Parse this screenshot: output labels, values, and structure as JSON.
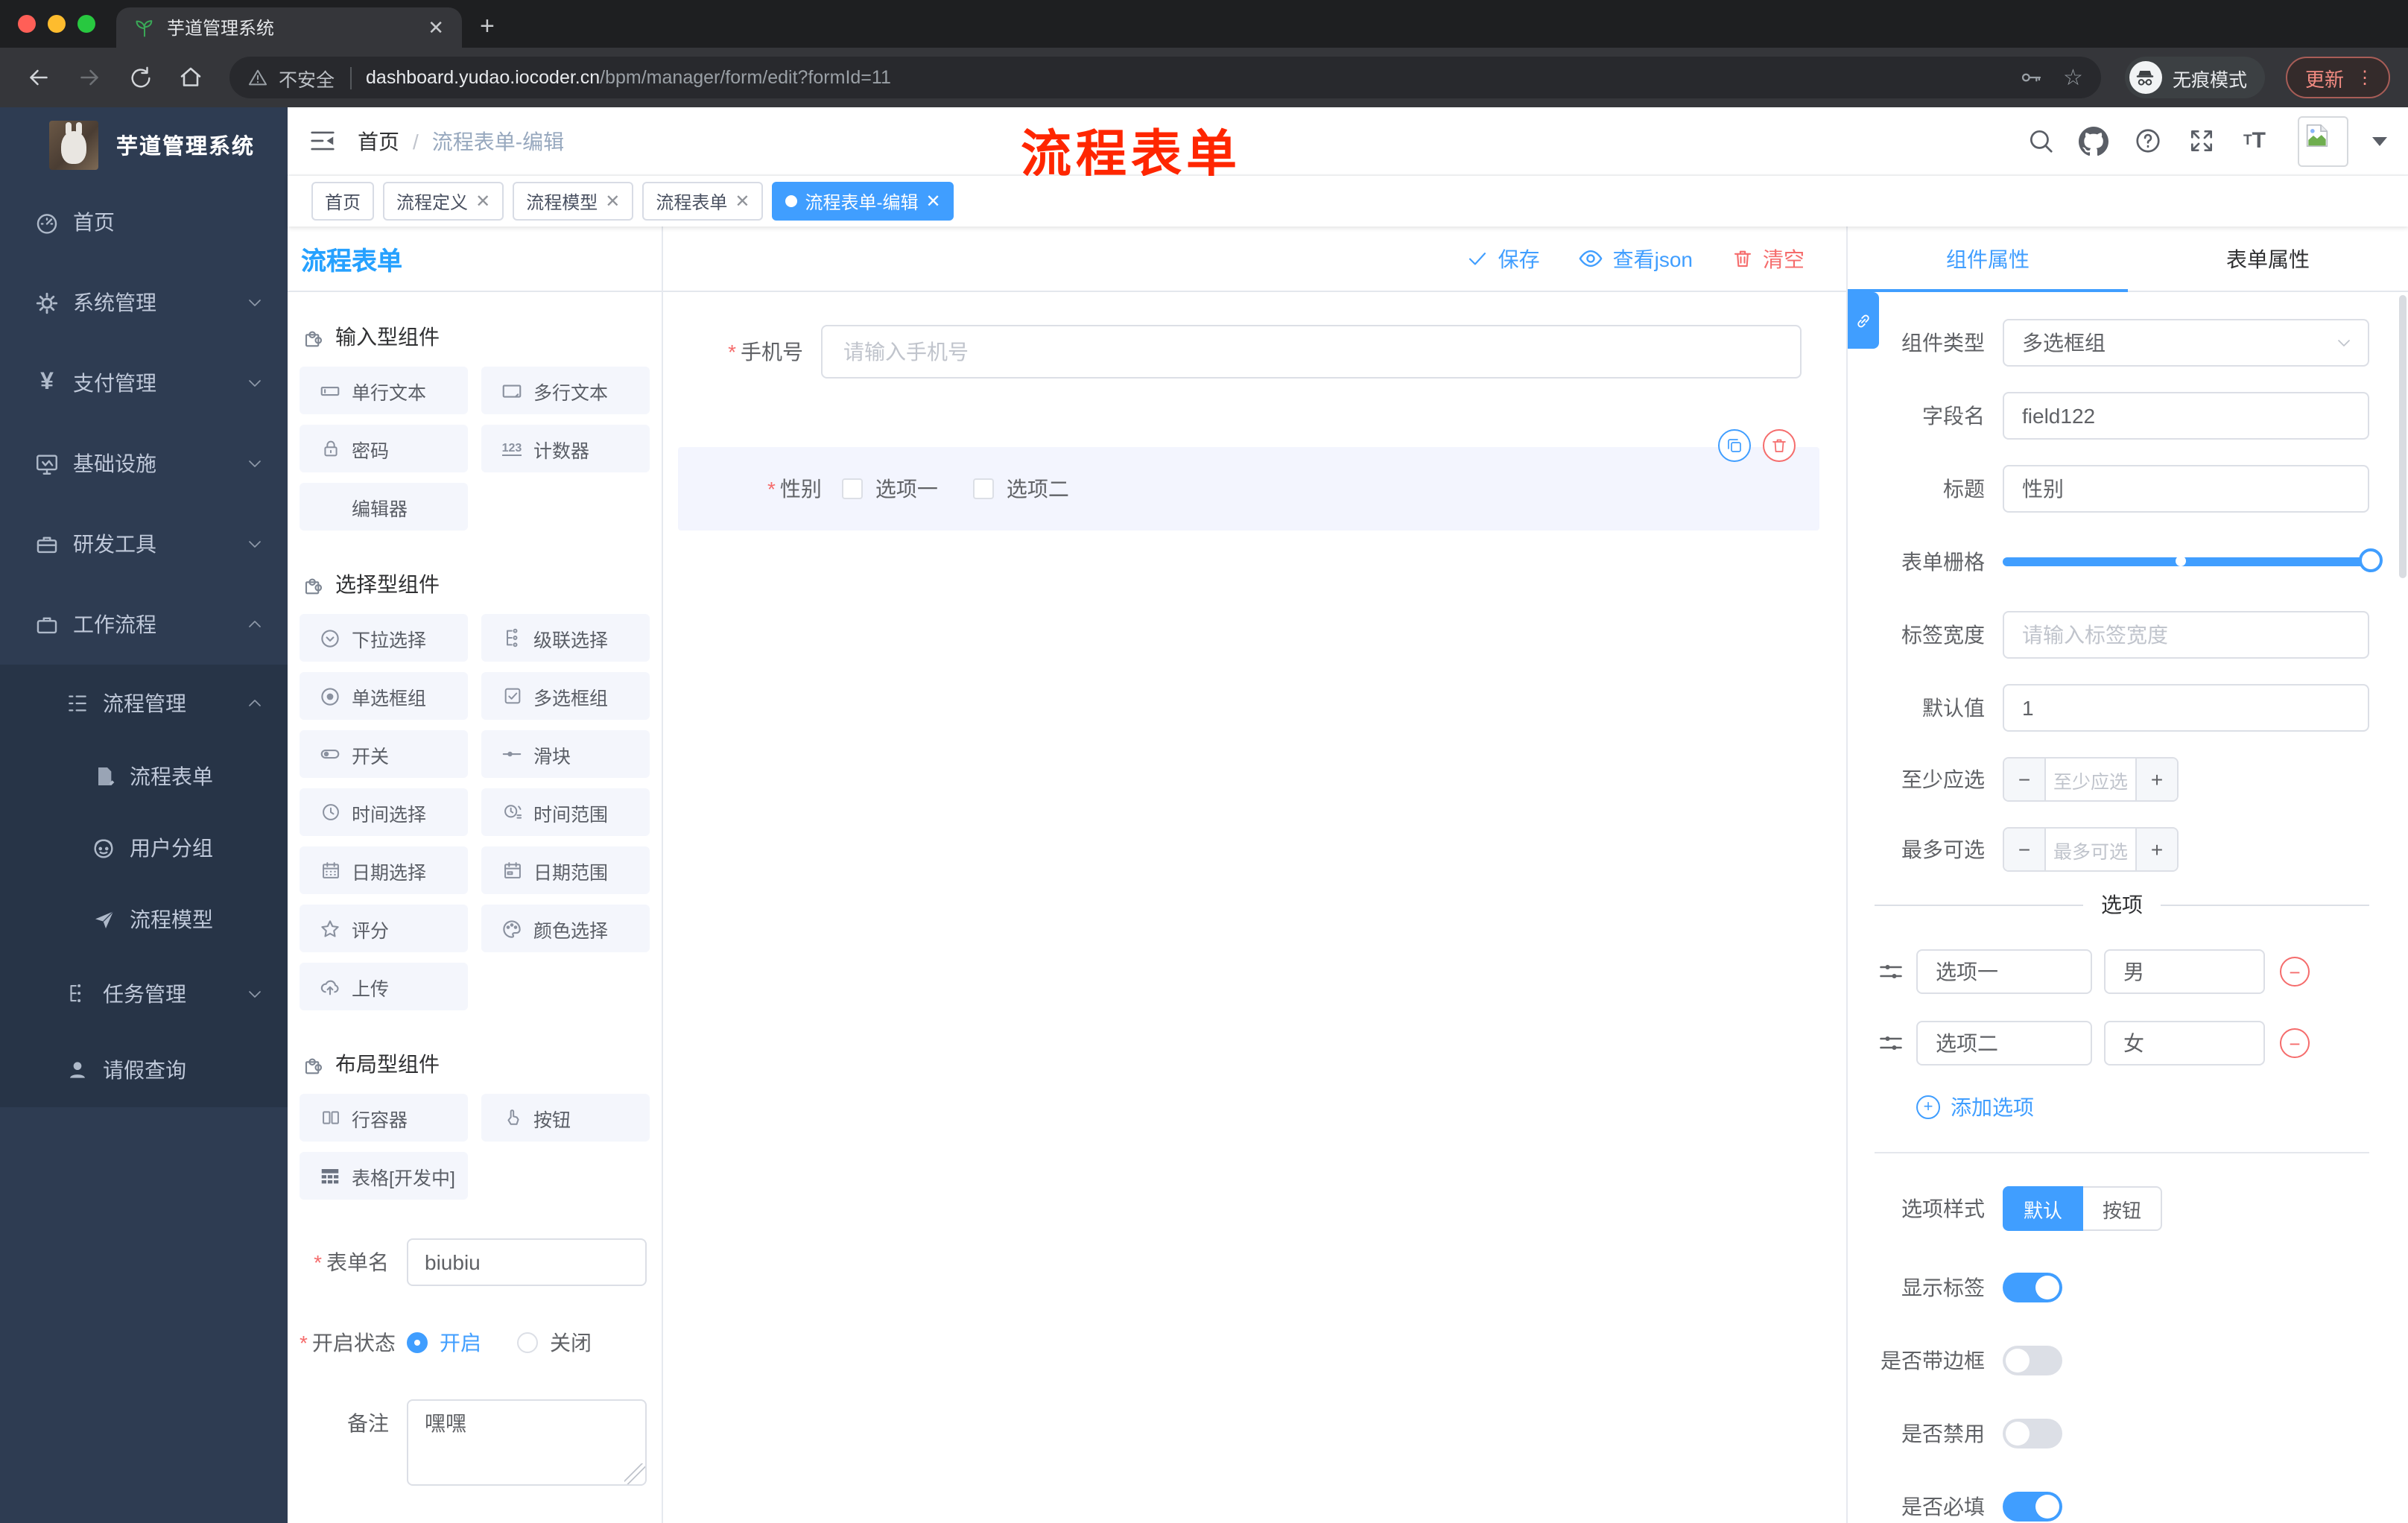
{
  "browser": {
    "tab_title": "芋道管理系统",
    "security_label": "不安全",
    "url_domain": "dashboard.yudao.iocoder.cn",
    "url_path": "/bpm/manager/form/edit?formId=11",
    "incognito_label": "无痕模式",
    "update_label": "更新"
  },
  "annotation_text": "流程表单",
  "sidebar": {
    "logo_title": "芋道管理系统",
    "items": [
      {
        "label": "首页"
      },
      {
        "label": "系统管理"
      },
      {
        "label": "支付管理"
      },
      {
        "label": "基础设施"
      },
      {
        "label": "研发工具"
      },
      {
        "label": "工作流程"
      },
      {
        "label": "流程管理"
      },
      {
        "label": "流程表单"
      },
      {
        "label": "用户分组"
      },
      {
        "label": "流程模型"
      },
      {
        "label": "任务管理"
      },
      {
        "label": "请假查询"
      }
    ]
  },
  "header": {
    "breadcrumb_home": "首页",
    "breadcrumb_current": "流程表单-编辑"
  },
  "tags": [
    {
      "label": "首页"
    },
    {
      "label": "流程定义"
    },
    {
      "label": "流程模型"
    },
    {
      "label": "流程表单"
    },
    {
      "label": "流程表单-编辑"
    }
  ],
  "left_panel": {
    "title": "流程表单",
    "sections": [
      {
        "title": "输入型组件",
        "items": [
          "单行文本",
          "多行文本",
          "密码",
          "计数器",
          "编辑器"
        ]
      },
      {
        "title": "选择型组件",
        "items": [
          "下拉选择",
          "级联选择",
          "单选框组",
          "多选框组",
          "开关",
          "滑块",
          "时间选择",
          "时间范围",
          "日期选择",
          "日期范围",
          "评分",
          "颜色选择",
          "上传"
        ]
      },
      {
        "title": "布局型组件",
        "items": [
          "行容器",
          "按钮",
          "表格[开发中]"
        ]
      }
    ],
    "form": {
      "name_label": "表单名",
      "name_value": "biubiu",
      "status_label": "开启状态",
      "status_on": "开启",
      "status_off": "关闭",
      "remark_label": "备注",
      "remark_value": "嘿嘿"
    }
  },
  "canvas": {
    "save_label": "保存",
    "view_json_label": "查看json",
    "clear_label": "清空",
    "phone_label": "手机号",
    "phone_placeholder": "请输入手机号",
    "gender_label": "性别",
    "gender_option1": "选项一",
    "gender_option2": "选项二"
  },
  "right_panel": {
    "tab_component": "组件属性",
    "tab_form": "表单属性",
    "type_label": "组件类型",
    "type_value": "多选框组",
    "field_label": "字段名",
    "field_value": "field122",
    "title_label": "标题",
    "title_value": "性别",
    "grid_label": "表单栅格",
    "label_width_label": "标签宽度",
    "label_width_placeholder": "请输入标签宽度",
    "default_label": "默认值",
    "default_value": "1",
    "min_label": "至少应选",
    "min_placeholder": "至少应选",
    "max_label": "最多可选",
    "max_placeholder": "最多可选",
    "options_title": "选项",
    "options": [
      {
        "name": "选项一",
        "value": "男"
      },
      {
        "name": "选项二",
        "value": "女"
      }
    ],
    "add_option_label": "添加选项",
    "style_label": "选项样式",
    "style_default": "默认",
    "style_button": "按钮",
    "show_label_label": "显示标签",
    "border_label": "是否带边框",
    "disabled_label": "是否禁用",
    "required_label": "是否必填"
  },
  "colors": {
    "primary": "#409eff",
    "danger": "#f56c6c",
    "annotation_red": "#ff2600"
  }
}
